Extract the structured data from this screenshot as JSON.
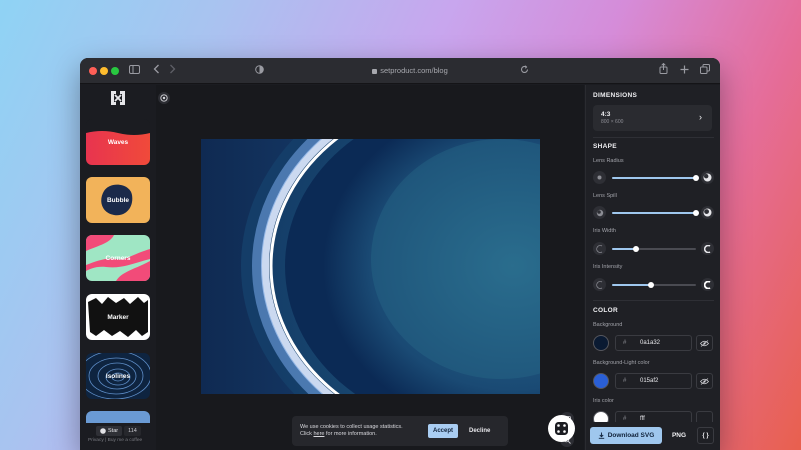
{
  "browser": {
    "url": "setproduct.com/blog"
  },
  "sidebar": {
    "items": [
      {
        "label": "Waves"
      },
      {
        "label": "Bubble"
      },
      {
        "label": "Corners"
      },
      {
        "label": "Marker"
      },
      {
        "label": "Isolines"
      }
    ],
    "github": {
      "star_label": "Star",
      "count": "114"
    },
    "footer_text": "Privacy | Buy me a coffee"
  },
  "cookie": {
    "line1": "We use cookies to collect usage statistics.",
    "line2_prefix": "Click ",
    "link": "here",
    "line2_suffix": " for more information.",
    "accept_label": "Accept",
    "decline_label": "Decline"
  },
  "panel": {
    "dimensions": {
      "title": "DIMENSIONS",
      "ratio": "4:3",
      "size": "800 × 600"
    },
    "shape": {
      "title": "SHAPE",
      "sliders": [
        {
          "label": "Lens Radius",
          "value": 1.0
        },
        {
          "label": "Lens Spill",
          "value": 1.0
        },
        {
          "label": "Iris Width",
          "value": 0.28
        },
        {
          "label": "Iris Intensity",
          "value": 0.46
        }
      ]
    },
    "color": {
      "title": "COLOR",
      "items": [
        {
          "label": "Background",
          "hex": "0a1a32",
          "swatch": "#0a1a32"
        },
        {
          "label": "Background-Light color",
          "hex": "015af2",
          "swatch": "#2a5fd6"
        },
        {
          "label": "Iris color",
          "hex": "fff",
          "swatch": "#ffffff"
        }
      ]
    },
    "actions": {
      "download_svg": "Download SVG",
      "png": "PNG",
      "code": "{ }"
    }
  },
  "colors": {
    "accent": "#9fc7ee",
    "window_bg": "#1b1c21",
    "panel_bg": "#1f2025"
  }
}
